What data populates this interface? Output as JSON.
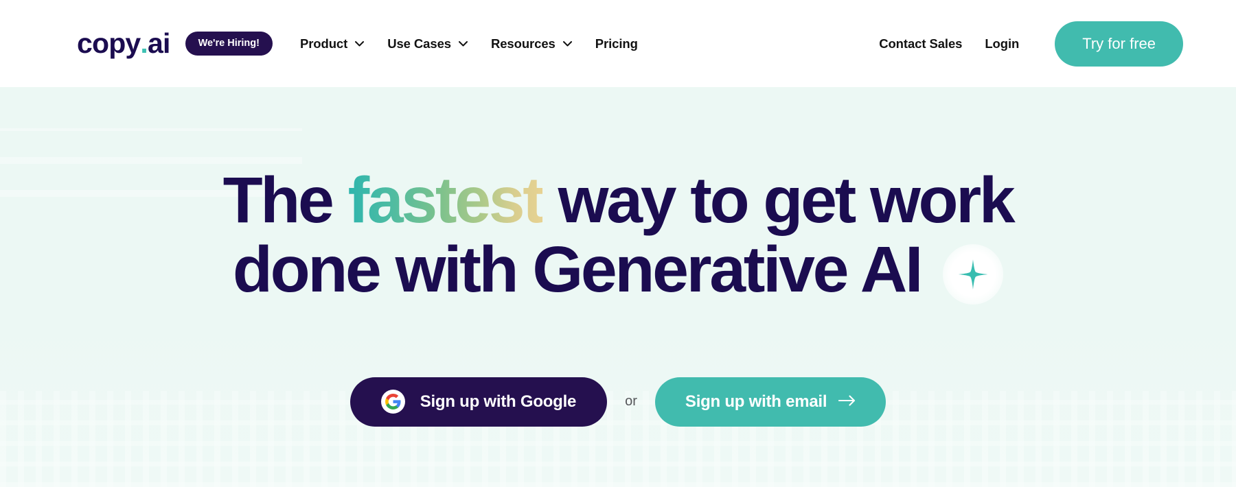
{
  "header": {
    "logo": {
      "name": "copy",
      "dot": ".",
      "suffix": "ai"
    },
    "hiring_badge": "We're Hiring!",
    "nav": [
      {
        "label": "Product",
        "has_dropdown": true,
        "icon": "chevron-down-icon"
      },
      {
        "label": "Use Cases",
        "has_dropdown": true,
        "icon": "chevron-down-icon"
      },
      {
        "label": "Resources",
        "has_dropdown": true,
        "icon": "chevron-down-icon"
      },
      {
        "label": "Pricing",
        "has_dropdown": false,
        "icon": ""
      }
    ],
    "contact_sales": "Contact Sales",
    "login": "Login",
    "try_free": "Try for free"
  },
  "hero": {
    "headline_line1_part1": "The ",
    "headline_line1_highlight": "fastest",
    "headline_line1_part2": " way to get work",
    "headline_line2": "done with Generative AI",
    "sparkle_icon": "sparkle-icon",
    "cta_google": "Sign up with Google",
    "google_icon": "google-g-icon",
    "or_divider": "or",
    "cta_email": "Sign up with email",
    "arrow_icon": "arrow-right-icon"
  },
  "colors": {
    "brand_navy": "#1B0C50",
    "deep_purple": "#25104F",
    "teal": "#41BBAE",
    "teal_bright": "#3EC1B3",
    "hero_bg": "#ECF8F4",
    "header_bg": "#FFFFFF",
    "text_dark": "#121212",
    "muted": "#55565A",
    "gradient_start": "#2EB5AD",
    "gradient_mid": "#78C18D",
    "gradient_end": "#E7D292"
  }
}
